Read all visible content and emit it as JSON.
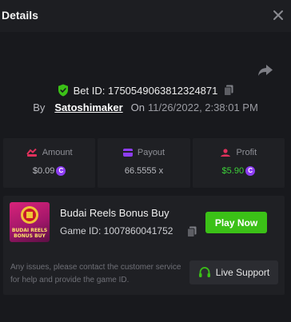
{
  "header": {
    "title": "Details",
    "close_icon": "close-icon"
  },
  "bet": {
    "bet_id_label": "Bet ID: 1750549063812324871",
    "by_label": "By",
    "username": "Satoshimaker",
    "on_label": "On",
    "date": "11/26/2022, 2:38:01 PM"
  },
  "stats": {
    "amount": {
      "label": "Amount",
      "value": "$0.09",
      "icon": "bet-amount-icon",
      "color": "#e0315c"
    },
    "payout": {
      "label": "Payout",
      "value": "66.5555 x",
      "icon": "payout-icon",
      "color": "#8d3df2"
    },
    "profit": {
      "label": "Profit",
      "value": "$5.90",
      "icon": "profit-icon",
      "color": "#e0315c",
      "value_color": "#3dd13a"
    }
  },
  "game": {
    "thumb_text": "BUDAI REELS BONUS BUY",
    "name": "Budai Reels Bonus Buy",
    "game_id_label": "Game ID: 1007860041752",
    "play_label": "Play Now",
    "note": "Any issues, please contact the customer service for help and provide the game ID.",
    "support_label": "Live Support"
  },
  "colors": {
    "accent_green": "#3bc117",
    "coin_purple": "#8d3df2",
    "background": "#18191d",
    "panel": "#1f2024"
  }
}
